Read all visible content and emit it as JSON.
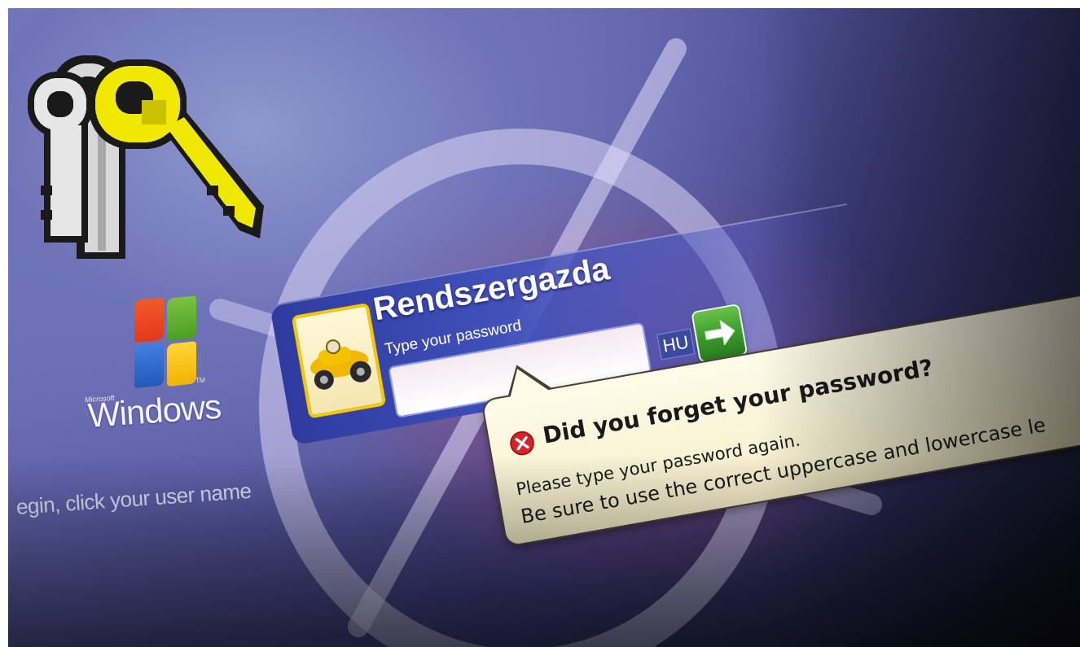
{
  "branding": {
    "microsoft_label": "Microsoft",
    "windows_label": "Windows",
    "trademark": "TM"
  },
  "welcome": {
    "instruction": "egin, click your user name"
  },
  "account": {
    "user_name": "Rendszergazda",
    "password_label": "Type your password",
    "password_value": "",
    "language_indicator": "HU",
    "avatar_icon": "race-car-icon",
    "submit_icon": "arrow-right-icon"
  },
  "balloon": {
    "icon": "error-icon",
    "title": "Did you forget your password?",
    "line1": "Please type your password again.",
    "line2": "Be sure to use the correct uppercase and lowercase le"
  },
  "decorations": {
    "key_icon": "keys-icon"
  },
  "colors": {
    "background": "#5c5ea8",
    "tile": "#3e4fb8",
    "avatar_border": "#f5c800",
    "go_button": "#3a9a2a",
    "balloon": "#fffbe8",
    "error": "#d8222a",
    "key_yellow": "#f0e800"
  }
}
